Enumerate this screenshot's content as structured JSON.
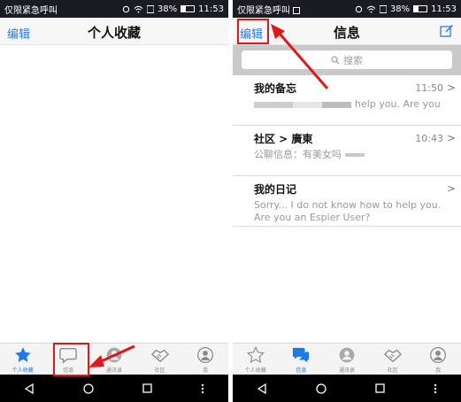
{
  "status": {
    "carrier": "仅限紧急呼叫",
    "battery": "38%",
    "time": "11:53"
  },
  "left": {
    "nav": {
      "edit": "编辑",
      "title": "个人收藏"
    }
  },
  "right": {
    "nav": {
      "edit": "编辑",
      "title": "信息",
      "compose_icon": "compose-icon"
    },
    "search": {
      "placeholder": "搜索"
    },
    "messages": [
      {
        "name": "我的备忘",
        "time": "11:50",
        "preview": "help you. Are you"
      },
      {
        "name": "社区 > 廣東",
        "time": "10:43",
        "preview": "公聊信息：有美女吗"
      },
      {
        "name": "我的日记",
        "time": "",
        "preview": "Sorry... I do not know how to help you. Are you an Espier User?"
      }
    ]
  },
  "tabs_left": [
    {
      "label": "个人收藏",
      "icon": "star-icon"
    },
    {
      "label": "信息",
      "icon": "chat-bubble-icon"
    },
    {
      "label": "通讯录",
      "icon": "contacts-icon"
    },
    {
      "label": "社区",
      "icon": "handshake-icon"
    },
    {
      "label": "我",
      "icon": "person-icon"
    }
  ],
  "tabs_right": [
    {
      "label": "个人收藏",
      "icon": "star-icon"
    },
    {
      "label": "信息",
      "icon": "chat-bubble-icon"
    },
    {
      "label": "通讯录",
      "icon": "contacts-icon"
    },
    {
      "label": "社区",
      "icon": "handshake-icon"
    },
    {
      "label": "我",
      "icon": "person-icon"
    }
  ],
  "colors": {
    "accent": "#1e7be6",
    "annotation": "#e01818",
    "status_bar": "#1a1c22"
  }
}
